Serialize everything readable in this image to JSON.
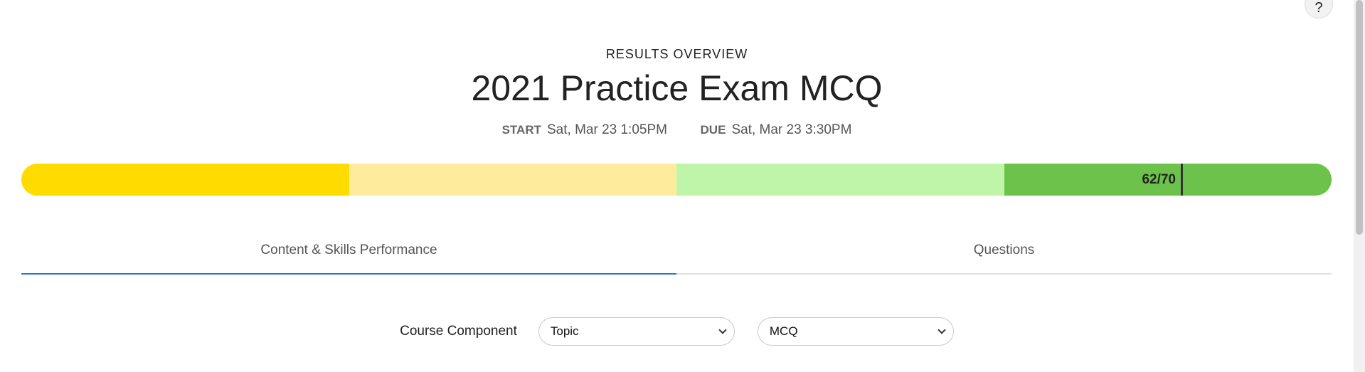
{
  "header": {
    "overline": "RESULTS OVERVIEW",
    "title": "2021 Practice Exam MCQ",
    "start_label": "START",
    "start_value": "Sat, Mar 23 1:05PM",
    "due_label": "DUE",
    "due_value": "Sat, Mar 23 3:30PM"
  },
  "help": {
    "label": "?"
  },
  "score": {
    "text": "62/70",
    "earned": 62,
    "total": 70,
    "band_colors": [
      "#ffdb00",
      "#ffeb9c",
      "#bff5a8",
      "#6cc24a"
    ]
  },
  "tabs": [
    {
      "label": "Content & Skills Performance",
      "active": true
    },
    {
      "label": "Questions",
      "active": false
    }
  ],
  "filters": {
    "label": "Course Component",
    "select_1": "Topic",
    "select_2": "MCQ"
  },
  "colors": {
    "accent": "#1f7ad0"
  }
}
